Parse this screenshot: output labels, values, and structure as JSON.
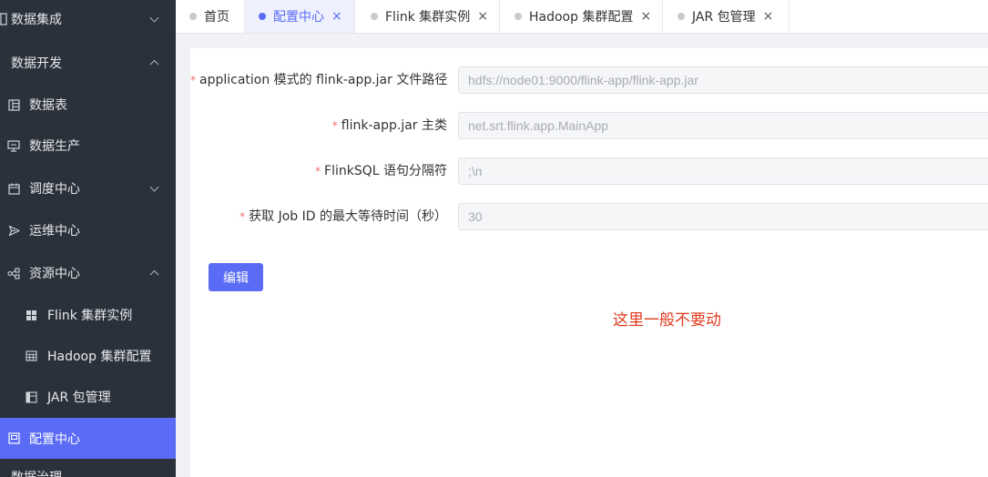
{
  "sidebar": {
    "items": [
      {
        "label": "数据集成",
        "icon": "grid-icon"
      },
      {
        "label": "数据开发"
      },
      {
        "label": "数据表",
        "icon": "table-icon"
      },
      {
        "label": "数据生产",
        "icon": "monitor-icon"
      },
      {
        "label": "调度中心",
        "icon": "calendar-icon"
      },
      {
        "label": "运维中心",
        "icon": "send-icon"
      },
      {
        "label": "资源中心",
        "icon": "share-icon"
      },
      {
        "label": "Flink 集群实例",
        "icon": "grid-four-icon"
      },
      {
        "label": "Hadoop 集群配置",
        "icon": "table-icon"
      },
      {
        "label": "JAR 包管理",
        "icon": "layout-icon"
      },
      {
        "label": "配置中心",
        "icon": "window-icon"
      },
      {
        "label": "数据治理"
      }
    ]
  },
  "tabs": [
    {
      "label": "首页",
      "closable": false
    },
    {
      "label": "配置中心",
      "closable": true,
      "active": true
    },
    {
      "label": "Flink 集群实例",
      "closable": true
    },
    {
      "label": "Hadoop 集群配置",
      "closable": true
    },
    {
      "label": "JAR 包管理",
      "closable": true
    }
  ],
  "tab_close_glyph": "×",
  "form": {
    "required_mark": "*",
    "fields": [
      {
        "label": "application 模式的 flink-app.jar 文件路径",
        "value": "hdfs://node01:9000/flink-app/flink-app.jar"
      },
      {
        "label": "flink-app.jar 主类",
        "value": "net.srt.flink.app.MainApp"
      },
      {
        "label": "FlinkSQL 语句分隔符",
        "value": ";\\n"
      },
      {
        "label": "获取 Job ID 的最大等待时间（秒）",
        "value": "30"
      }
    ],
    "edit_button": "编辑"
  },
  "annotation": "这里一般不要动",
  "colors": {
    "accent": "#5a6cf5",
    "sidebar_bg": "#2b313b",
    "annotation": "#e03b1f",
    "required": "#f56c6c"
  }
}
